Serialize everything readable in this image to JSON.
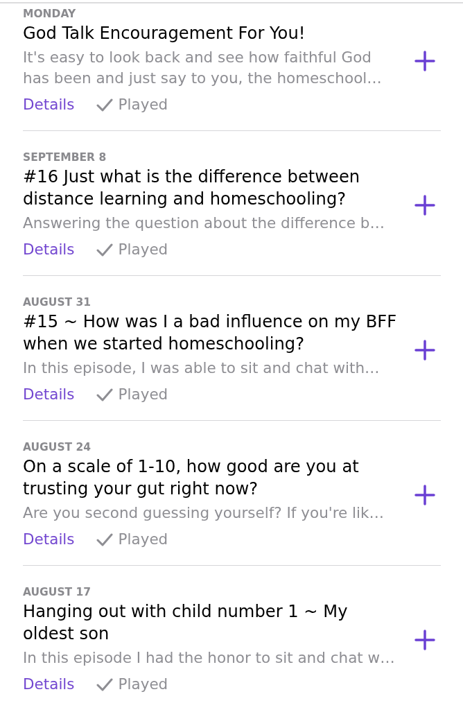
{
  "episodes": [
    {
      "date": "MONDAY",
      "title": "God Talk Encouragement For You!",
      "description": "It's easy to look back and see how faithful God has been and just say to you, the homeschool…",
      "details_label": "Details",
      "played": true,
      "played_label": "Played"
    },
    {
      "date": "SEPTEMBER 8",
      "title": "#16 Just what is the difference between distance learning and homeschooling?",
      "description": "Answering the question about the difference b…",
      "details_label": "Details",
      "played": true,
      "played_label": "Played"
    },
    {
      "date": "AUGUST 31",
      "title": "#15 ~ How was I a bad influence on my BFF when we started homeschooling?",
      "description": "In this episode, I was able to sit and chat with…",
      "details_label": "Details",
      "played": true,
      "played_label": "Played"
    },
    {
      "date": "AUGUST 24",
      "title": "On a scale of 1-10, how good are you at trusting your gut right now?",
      "description": "Are you second guessing yourself? If you're lik…",
      "details_label": "Details",
      "played": true,
      "played_label": "Played"
    },
    {
      "date": "AUGUST 17",
      "title": "Hanging out with child number 1 ~ My oldest son",
      "description": "In this episode I had the honor to sit and chat w…",
      "details_label": "Details",
      "played": true,
      "played_label": "Played"
    }
  ]
}
